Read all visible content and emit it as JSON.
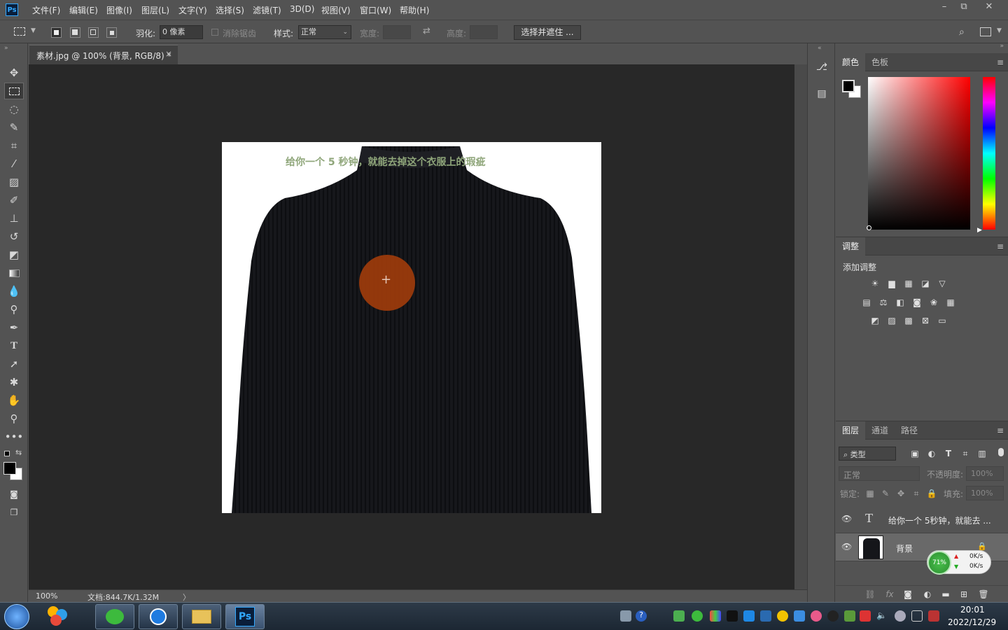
{
  "app": {
    "logo": "Ps"
  },
  "menu": [
    "文件(F)",
    "编辑(E)",
    "图像(I)",
    "图层(L)",
    "文字(Y)",
    "选择(S)",
    "滤镜(T)",
    "3D(D)",
    "视图(V)",
    "窗口(W)",
    "帮助(H)"
  ],
  "window_controls": {
    "minimize": "–",
    "restore": "⧉",
    "close": "✕"
  },
  "options": {
    "feather_label": "羽化:",
    "feather_value": "0 像素",
    "antialias_label": "消除锯齿",
    "style_label": "样式:",
    "style_value": "正常",
    "width_label": "宽度:",
    "height_label": "高度:",
    "select_mask_button": "选择并遮住 ..."
  },
  "document": {
    "tab_title": "素材.jpg @ 100% (背景, RGB/8) *",
    "tab_close": "×",
    "overlay_text": "给你一个 5 秒钟，就能去掉这个衣服上的瑕疵"
  },
  "status": {
    "zoom": "100%",
    "doc_info": "文档:844.7K/1.32M",
    "arrow": "〉"
  },
  "color_panel": {
    "tabs": [
      "颜色",
      "色板"
    ]
  },
  "adjustments_panel": {
    "tab": "调整",
    "add_label": "添加调整"
  },
  "layers_panel": {
    "tabs": [
      "图层",
      "通道",
      "路径"
    ],
    "filter_kind": "类型",
    "blend_mode": "正常",
    "opacity_label": "不透明度:",
    "opacity_value": "100%",
    "lock_label": "锁定:",
    "fill_label": "填充:",
    "fill_value": "100%",
    "layers": [
      {
        "name": "给你一个 5秒钟，就能去 ...",
        "type": "text"
      },
      {
        "name": "背景",
        "type": "image"
      }
    ]
  },
  "net_widget": {
    "percent": "71%",
    "up": "0K/s",
    "down": "0K/s"
  },
  "taskbar": {
    "time": "20:01",
    "date": "2022/12/29"
  },
  "colors": {
    "foreground": "#000000",
    "background": "#ffffff",
    "brush_cursor": "#9a3a0c",
    "overlay_text": "#8fa67a"
  }
}
